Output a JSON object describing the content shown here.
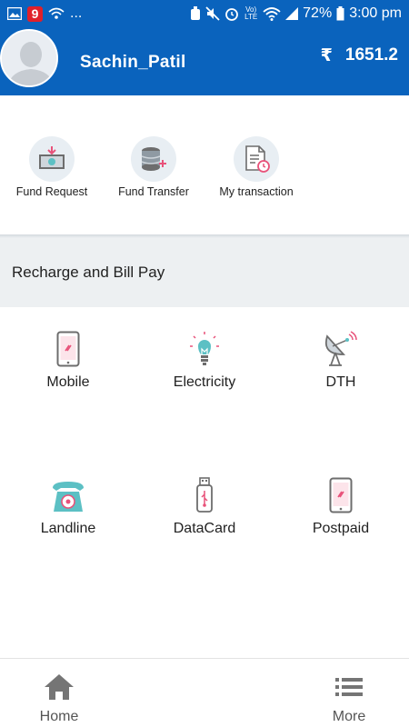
{
  "status_bar": {
    "notification_badge": "9",
    "overflow": "...",
    "network_label": "Vo) LTE",
    "battery_percent": "72%",
    "time": "3:00 pm"
  },
  "header": {
    "username": "Sachin_Patil",
    "currency_symbol": "₹",
    "balance": "1651.2"
  },
  "quick_actions": [
    {
      "label": "Fund Request",
      "icon": "fund-request-icon"
    },
    {
      "label": "Fund Transfer",
      "icon": "fund-transfer-icon"
    },
    {
      "label": "My transaction",
      "icon": "transaction-icon"
    }
  ],
  "section": {
    "title": "Recharge and Bill Pay"
  },
  "services": [
    {
      "label": "Mobile",
      "icon": "mobile-icon"
    },
    {
      "label": "Electricity",
      "icon": "bulb-icon"
    },
    {
      "label": "DTH",
      "icon": "satellite-dish-icon"
    },
    {
      "label": "Landline",
      "icon": "telephone-icon"
    },
    {
      "label": "DataCard",
      "icon": "usb-icon"
    },
    {
      "label": "Postpaid",
      "icon": "postpaid-mobile-icon"
    }
  ],
  "bottom_nav": {
    "home_label": "Home",
    "more_label": "More"
  },
  "colors": {
    "primary": "#0a63bd",
    "accent_pink": "#e8527a",
    "icon_gray": "#6d6d6d",
    "teal": "#5cc0c4"
  }
}
